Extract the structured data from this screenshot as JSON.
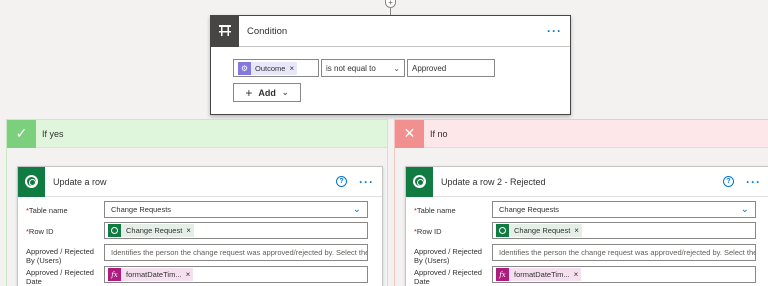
{
  "connector": {
    "plus": "+"
  },
  "condition": {
    "title": "Condition",
    "more": "···",
    "left_token": "Outcome",
    "token_close": "×",
    "operator": "is not equal to",
    "right_value": "Approved",
    "add_label": "Add",
    "add_plus": "+",
    "add_chevron": "⌵"
  },
  "branches": {
    "yes": {
      "label": "If yes",
      "icon": "✓",
      "action": {
        "title": "Update a row",
        "help": "?",
        "more": "···",
        "fields": {
          "table_name_label": "Table name",
          "table_name_value": "Change Requests",
          "row_id_label": "Row ID",
          "row_id_token": "Change Request",
          "approved_by_label": "Approved / Rejected By (Users)",
          "approved_by_placeholder": "Identifies the person the change request was approved/rejected by. Select the c",
          "approved_date_label": "Approved / Rejected Date",
          "approved_date_token": "formatDateTim..."
        }
      }
    },
    "no": {
      "label": "If no",
      "icon": "✕",
      "action": {
        "title": "Update a row 2 - Rejected",
        "help": "?",
        "more": "···",
        "fields": {
          "table_name_label": "Table name",
          "table_name_value": "Change Requests",
          "row_id_label": "Row ID",
          "row_id_token": "Change Request",
          "approved_by_label": "Approved / Rejected By (Users)",
          "approved_by_placeholder": "Identifies the person the change request was approved/rejected by. Select the c",
          "approved_date_label": "Approved / Rejected Date",
          "approved_date_token": "formatDateTim..."
        }
      }
    }
  },
  "common": {
    "required_marker": "*",
    "token_close": "×",
    "chevron": "⌄",
    "fx": "fx"
  }
}
